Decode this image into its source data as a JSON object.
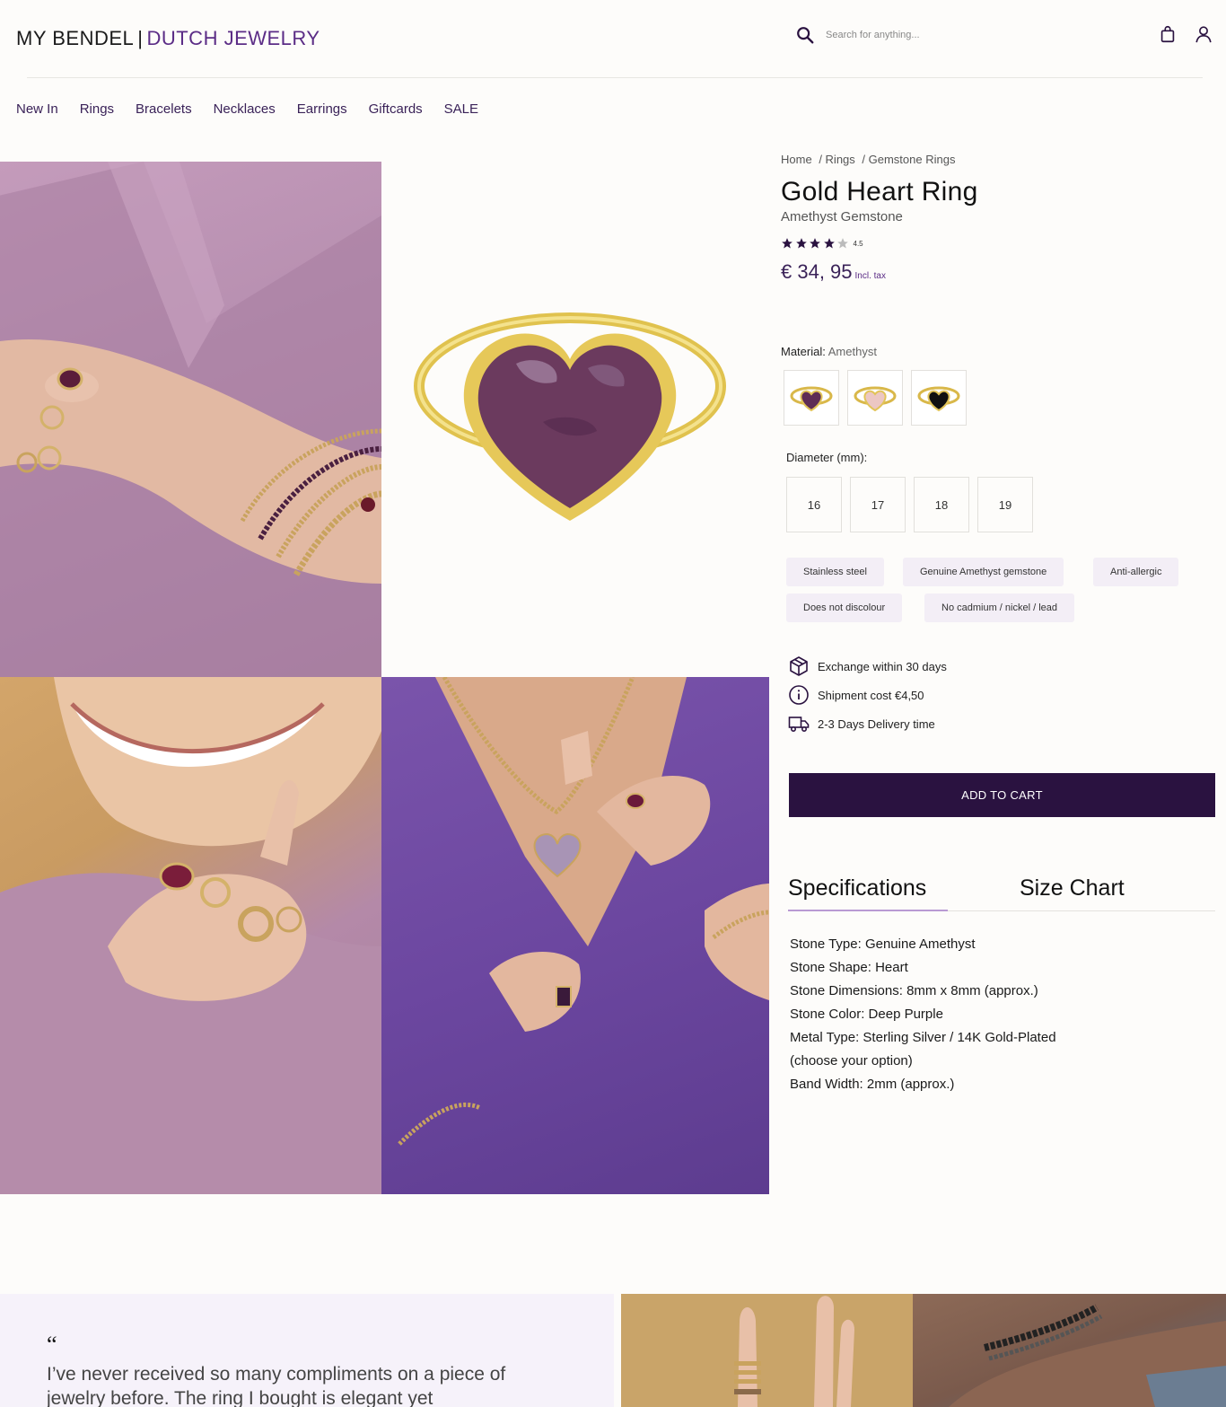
{
  "header": {
    "brand": "MY BENDEL",
    "separator": "|",
    "tagline": "DUTCH JEWELRY",
    "search_placeholder": "Search for anything..."
  },
  "nav": [
    "New In",
    "Rings",
    "Bracelets",
    "Necklaces",
    "Earrings",
    "Giftcards",
    "SALE"
  ],
  "breadcrumb": [
    "Home",
    "/ Rings",
    "/ Gemstone Rings"
  ],
  "product": {
    "title": "Gold Heart Ring",
    "subtitle": "Amethyst Gemstone",
    "rating": "4.5",
    "rating_value": 4.5,
    "price": "€ 34, 95",
    "tax": "Incl. tax",
    "material_label": "Material:",
    "material_value": "Amethyst",
    "swatches": [
      "amethyst",
      "rose-quartz",
      "onyx"
    ],
    "diameter_label": "Diameter (mm):",
    "sizes": [
      "16",
      "17",
      "18",
      "19"
    ],
    "features": [
      "Stainless steel",
      "Genuine Amethyst gemstone",
      "Anti-allergic",
      "Does not discolour",
      "No cadmium / nickel / lead"
    ],
    "perks": [
      {
        "icon": "box-icon",
        "text": "Exchange within 30 days"
      },
      {
        "icon": "info-icon",
        "text": "Shipment cost €4,50"
      },
      {
        "icon": "truck-icon",
        "text": "2-3 Days Delivery time"
      }
    ],
    "add_to_cart": "ADD TO CART"
  },
  "tabs": {
    "specifications": "Specifications",
    "size_chart": "Size Chart"
  },
  "specs": [
    "Stone Type: Genuine Amethyst",
    "Stone Shape: Heart",
    "Stone Dimensions: 8mm x 8mm (approx.)",
    "Stone Color: Deep Purple",
    "Metal Type: Sterling Silver / 14K Gold-Plated",
    "(choose your option)",
    "Band Width: 2mm (approx.)"
  ],
  "testimonial": {
    "mark": "“",
    "text": "I’ve never received so many compliments on a piece of jewelry before. The ring I bought is elegant yet"
  },
  "colors": {
    "accent": "#5b2c86",
    "nav": "#3a2258",
    "cart_bg": "#2a1240",
    "chip_bg": "#f3eef6"
  }
}
